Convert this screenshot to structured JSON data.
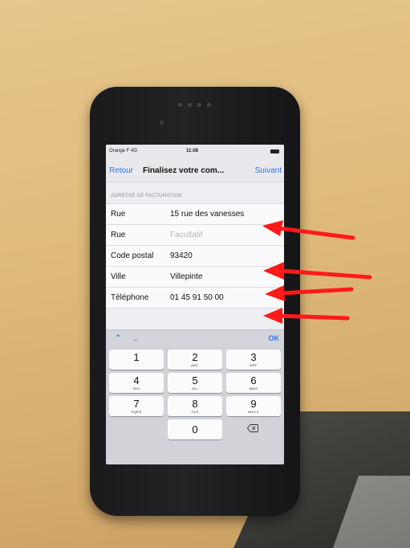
{
  "status_bar": {
    "carrier": "Orange F 4G",
    "time": "11:08"
  },
  "nav": {
    "back_label": "Retour",
    "title": "Finalisez votre com...",
    "next_label": "Suivant"
  },
  "section_header": "ADRESSE DE FACTURATION",
  "form_rows": [
    {
      "label": "Rue",
      "value": "15 rue des vanesses",
      "placeholder": false
    },
    {
      "label": "Rue",
      "value": "Facultatif",
      "placeholder": true
    },
    {
      "label": "Code postal",
      "value": "93420",
      "placeholder": false
    },
    {
      "label": "Ville",
      "value": "Villepinte",
      "placeholder": false
    },
    {
      "label": "Téléphone",
      "value": "01 45 91 50 00",
      "placeholder": false
    }
  ],
  "accessory": {
    "up_icon": "chevron-up-icon",
    "down_icon": "chevron-down-icon",
    "ok_label": "OK"
  },
  "keypad": {
    "keys": [
      {
        "num": "1",
        "letters": ""
      },
      {
        "num": "2",
        "letters": "ABC"
      },
      {
        "num": "3",
        "letters": "DEF"
      },
      {
        "num": "4",
        "letters": "GHI"
      },
      {
        "num": "5",
        "letters": "JKL"
      },
      {
        "num": "6",
        "letters": "MNO"
      },
      {
        "num": "7",
        "letters": "PQRS"
      },
      {
        "num": "8",
        "letters": "TUV"
      },
      {
        "num": "9",
        "letters": "WXYZ"
      },
      {
        "num": "0",
        "letters": ""
      }
    ],
    "delete_icon": "backspace-icon"
  },
  "colors": {
    "accent": "#2f74e8",
    "arrow": "#ff1a1a"
  }
}
